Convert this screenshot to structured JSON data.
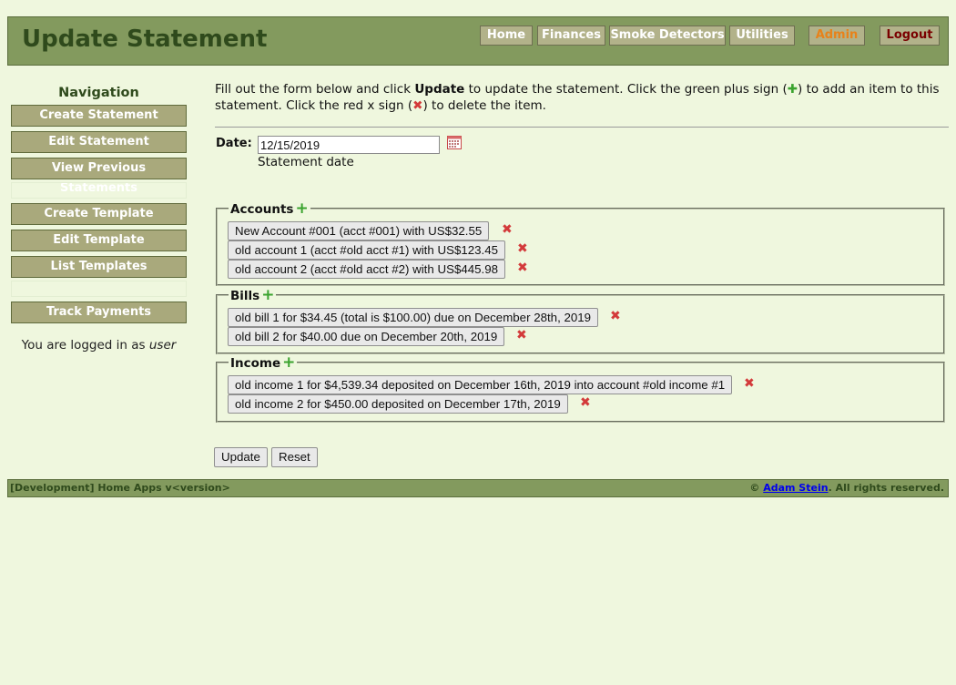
{
  "header": {
    "title": "Update Statement",
    "nav": [
      {
        "label": "Home"
      },
      {
        "label": "Finances"
      },
      {
        "label": "Smoke Detectors"
      },
      {
        "label": "Utilities"
      },
      {
        "label": "Admin",
        "color": "#e8821a"
      },
      {
        "label": "Logout",
        "color": "#7a0000"
      }
    ]
  },
  "sidebar": {
    "heading": "Navigation",
    "items": [
      {
        "label": "Create Statement"
      },
      {
        "label": "Edit Statement"
      },
      {
        "label": "View Previous Statements"
      },
      {
        "label": "Create Template"
      },
      {
        "label": "Edit Template"
      },
      {
        "label": "List Templates"
      },
      {
        "label": "Track Payments"
      }
    ],
    "logged_in_prefix": "You are logged in as ",
    "logged_in_user": "user"
  },
  "main": {
    "instructions": {
      "part1": "Fill out the form below and click ",
      "bold": "Update",
      "part2": " to update the statement. Click the green plus sign (",
      "plus_glyph": "✚",
      "part3": ") to add an item to this statement. Click the red x sign (",
      "x_glyph": "✖",
      "part4": ") to delete the item."
    },
    "date": {
      "label": "Date:",
      "value": "12/15/2019",
      "help": "Statement date"
    },
    "sections": [
      {
        "legend": "Accounts",
        "items": [
          "New Account #001 (acct #001) with US$32.55",
          "old account 1 (acct #old acct #1) with US$123.45",
          "old account 2 (acct #old acct #2) with US$445.98"
        ]
      },
      {
        "legend": "Bills",
        "items": [
          "old bill 1 for $34.45 (total is $100.00) due on December 28th, 2019",
          "old bill 2 for $40.00 due on December 20th, 2019"
        ]
      },
      {
        "legend": "Income",
        "items": [
          "old income 1 for $4,539.34 deposited on December 16th, 2019 into account #old income #1",
          "old income 2 for $450.00 deposited on December 17th, 2019"
        ]
      }
    ],
    "buttons": {
      "update": "Update",
      "reset": "Reset"
    }
  },
  "footer": {
    "left": "[Development] Home Apps v<version>",
    "copyright_symbol": "©",
    "author": "Adam Stein",
    "rights": ". All rights reserved."
  },
  "icons": {
    "add": "plus-icon",
    "delete": "x-icon",
    "calendar": "calendar-icon"
  },
  "colors": {
    "header_bg": "#839a5e",
    "page_bg": "#eff7de",
    "add_green": "#3aa32e",
    "delete_red": "#d33a3a"
  }
}
